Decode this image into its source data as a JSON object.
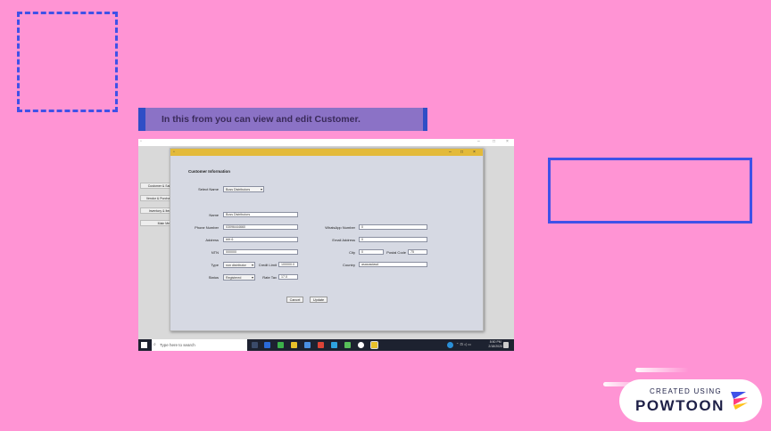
{
  "banner": {
    "text": "In this from you can view and edit Customer."
  },
  "side_menu": {
    "items": [
      "Customer & Sales",
      "Vendor & Purchase",
      "Inventory & Items",
      "Main Menu"
    ]
  },
  "dialog": {
    "heading": "Customer Information",
    "select_name_label": "Select Name",
    "select_name_value": "Boss Distributors",
    "fields": {
      "name": {
        "label": "Name",
        "value": "Boss Distributors"
      },
      "phone": {
        "label": "Phone Number",
        "value": "03096444660"
      },
      "address": {
        "label": "Address",
        "value": "trfrt 6"
      },
      "ntn": {
        "label": "NTN",
        "value": "000000"
      },
      "type": {
        "label": "Type",
        "value": "non distributor"
      },
      "credit_limit": {
        "label": "Credit Limit",
        "value": "100000.0"
      },
      "status": {
        "label": "Status",
        "value": "Registered"
      },
      "rate_tax": {
        "label": "Rate Tax",
        "value": "17.0"
      },
      "whatsapp": {
        "label": "WhatsApp Number",
        "value": "0"
      },
      "email": {
        "label": "Email Address",
        "value": "0"
      },
      "city": {
        "label": "City",
        "value": "0"
      },
      "postal_code": {
        "label": "Postal Code",
        "value": "75"
      },
      "country": {
        "label": "Country",
        "value": "asasasdasd"
      }
    },
    "cancel_label": "Cancel",
    "update_label": "Update"
  },
  "taskbar": {
    "search_placeholder": "Type here to search",
    "time": "8:50 PM",
    "date": "2/18/2020"
  },
  "powtoon": {
    "created_using": "CREATED USING",
    "logo": "POWTOON"
  },
  "colors": {
    "background": "#ff94d4",
    "accent_blue": "#3f51e8",
    "banner": "#8b72c6",
    "titlebar": "#e3ba3a"
  }
}
